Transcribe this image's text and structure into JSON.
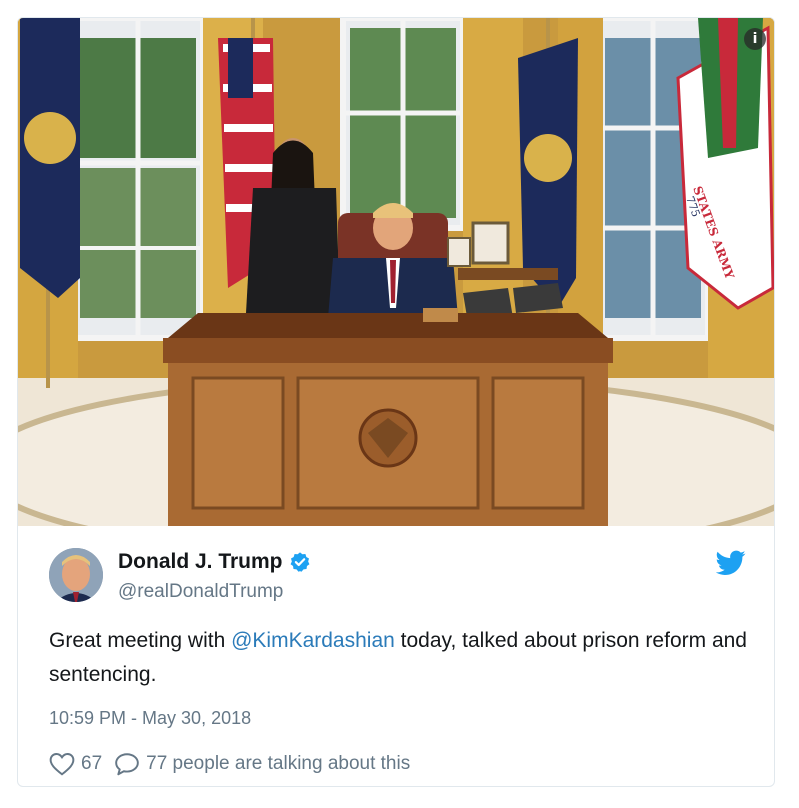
{
  "tweet": {
    "display_name": "Donald J. Trump",
    "handle": "@realDonaldTrump",
    "text_before": "Great meeting with ",
    "mention": "@KimKardashian",
    "text_after": " today, talked about prison reform and sentencing.",
    "timestamp": "10:59 PM - May 30, 2018",
    "likes": "67",
    "talking": "77 people are talking about this"
  },
  "photo": {
    "flag_label": "STATES ARMY",
    "flag_number": "775"
  },
  "icons": {
    "info": "info-icon",
    "verified": "verified-badge-icon",
    "bird": "twitter-bird-icon",
    "like": "heart-icon",
    "reply": "speech-bubble-icon"
  },
  "colors": {
    "accent": "#1da1f2",
    "mention": "#2b7bb9",
    "muted": "#657786",
    "text": "#14171a"
  }
}
